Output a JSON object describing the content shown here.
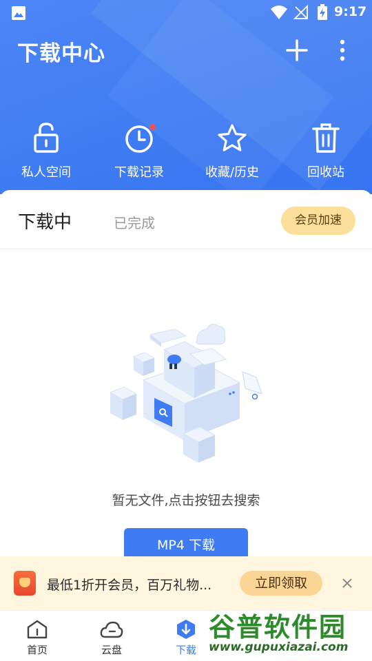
{
  "status_bar": {
    "time": "9:17"
  },
  "header": {
    "title": "下载中心",
    "quick_actions": [
      {
        "label": "私人空间",
        "icon": "lock-icon"
      },
      {
        "label": "下载记录",
        "icon": "clock-icon",
        "badge": true
      },
      {
        "label": "收藏/历史",
        "icon": "star-icon"
      },
      {
        "label": "回收站",
        "icon": "trash-icon"
      }
    ]
  },
  "tabs": {
    "active": "下载中",
    "inactive": "已完成",
    "vip_button": "会员加速"
  },
  "empty_state": {
    "message": "暂无文件,点击按钮去搜索",
    "button": "MP4 下载"
  },
  "promo": {
    "text": "最低1折开会员，百万礼物...",
    "button": "立即领取"
  },
  "bottom_nav": [
    {
      "label": "首页",
      "icon": "home-icon"
    },
    {
      "label": "云盘",
      "icon": "cloud-icon"
    },
    {
      "label": "下载",
      "icon": "download-icon",
      "active": true
    }
  ],
  "watermark": {
    "title": "谷普软件园",
    "url": "www.gupuxiazai.com"
  },
  "colors": {
    "primary": "#3f7cf3",
    "vip": "#fbdf9a",
    "promo_bg": "#fff6df",
    "badge": "#f15353"
  }
}
